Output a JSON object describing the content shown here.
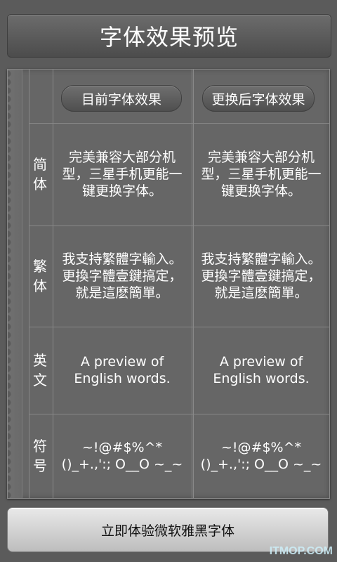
{
  "header": {
    "title": "字体效果预览"
  },
  "table": {
    "col_current": "目前字体效果",
    "col_new": "更换后字体效果",
    "rows": [
      {
        "label": "简体",
        "current": "完美兼容大部分机型，三星手机更能一键更换字体。",
        "new": "完美兼容大部分机型，三星手机更能一键更换字体。"
      },
      {
        "label": "繁体",
        "current": "我支持繁體字輸入。更換字體壹鍵搞定，就是這麽簡單。",
        "new": "我支持繁體字輸入。更換字體壹鍵搞定，就是這麽簡單。"
      },
      {
        "label": "英文",
        "current": "A preview of English words.",
        "new": "A preview of English words."
      },
      {
        "label": "符号",
        "current": "~!@#$%^*()_+.,':; O__O ~_~",
        "new": "~!@#$%^*()_+.,':; O__O ~_~"
      }
    ]
  },
  "footer": {
    "action_label": "立即体验微软雅黑字体"
  },
  "watermark": "ITMOP.COM"
}
